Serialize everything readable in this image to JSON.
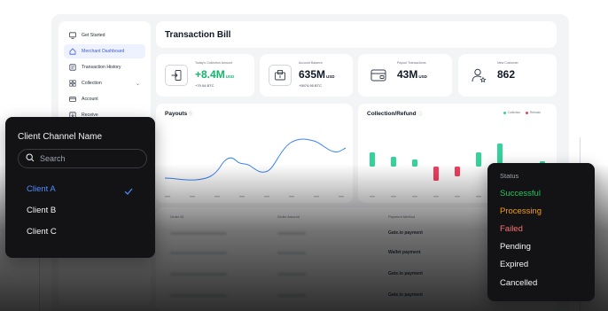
{
  "sidebar": {
    "items": [
      {
        "label": "Get Started",
        "icon": "monitor-icon"
      },
      {
        "label": "Merchant Dashboard",
        "icon": "home-icon",
        "active": true
      },
      {
        "label": "Transaction History",
        "icon": "list-icon"
      },
      {
        "label": "Collection",
        "icon": "grid-icon",
        "chevron": true
      },
      {
        "label": "Account",
        "icon": "card-icon"
      },
      {
        "label": "Receive",
        "icon": "receive-icon"
      }
    ]
  },
  "header": {
    "title": "Transaction Bill"
  },
  "stats": [
    {
      "title": "Today's Collection Amount",
      "value": "+8.4M",
      "unit": "USD",
      "sub": "+79.04 BTC"
    },
    {
      "title": "Account Balance",
      "value": "635M",
      "unit": "USD",
      "sub": "+5974.95 BTC"
    },
    {
      "title": "Payout Transactions",
      "value": "43M",
      "unit": "USD"
    },
    {
      "title": "New Customer",
      "value": "862"
    }
  ],
  "payouts": {
    "title": "Payouts"
  },
  "collection": {
    "title": "Collection/Refund",
    "legend": [
      "Collection",
      "Refunds"
    ]
  },
  "table": {
    "headers": [
      "Order ID",
      "Order Amount",
      "Payment Method"
    ],
    "payment_methods": [
      "Gate.io payment",
      "Wallet payment",
      "Gate.io payment",
      "Gate.io payment"
    ]
  },
  "client_popup": {
    "title": "Client Channel Name",
    "search_placeholder": "Search",
    "options": [
      "Client A",
      "Client B",
      "Client C"
    ],
    "selected": "Client A"
  },
  "status_popup": {
    "title": "Status",
    "options": [
      {
        "label": "Successful",
        "color": "#22c55e"
      },
      {
        "label": "Processing",
        "color": "#f59e0b"
      },
      {
        "label": "Failed",
        "color": "#f87171"
      },
      {
        "label": "Pending",
        "color": "#f3f4f6"
      },
      {
        "label": "Expired",
        "color": "#f3f4f6"
      },
      {
        "label": "Cancelled",
        "color": "#f3f4f6"
      }
    ]
  },
  "colors": {
    "accent": "#3b5bdb",
    "positive": "#12b76a",
    "collection_bar": "#34d399",
    "refund_bar": "#f43f5e",
    "line": "#3b82f6"
  }
}
